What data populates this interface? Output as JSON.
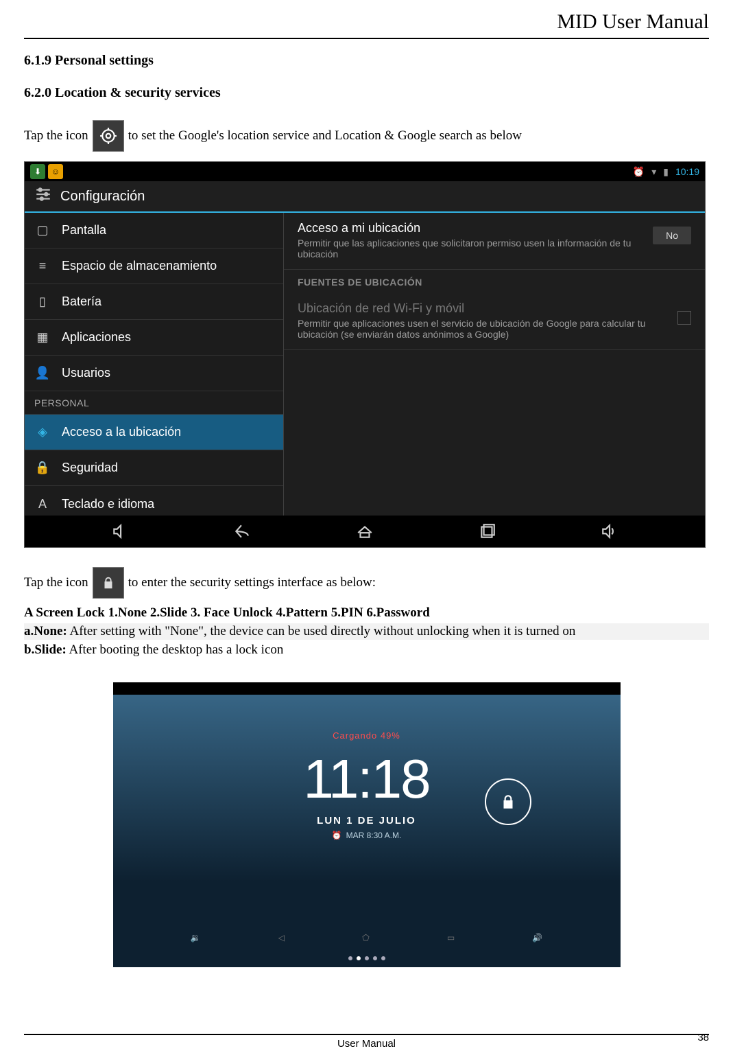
{
  "doc": {
    "header": "MID User Manual",
    "section1": "6.1.9 Personal settings",
    "section2": "6.2.0 Location & security services",
    "tap_line_pre": "Tap the icon",
    "tap_line1_post": "to set the Google's location service and Location & Google search as below",
    "tap_line2_post": "to enter the security settings interface as below:",
    "screen_lock_line": "A Screen Lock 1.None    2.Slide    3. Face Unlock    4.Pattern      5.PIN    6.Password",
    "a_none_label": "a.None:",
    "a_none_text": " After setting with \"None\", the device can be used directly without unlocking when it is turned on",
    "b_slide_label": "b.Slide:",
    "b_slide_text": " After booting the desktop has a lock icon",
    "footer": "User Manual",
    "page": "38"
  },
  "shot1": {
    "status": {
      "time": "10:19"
    },
    "title": "Configuración",
    "sidebar": {
      "personal_header": "PERSONAL",
      "items_top": [
        {
          "label": "Pantalla",
          "icon": "display"
        },
        {
          "label": "Espacio de almacenamiento",
          "icon": "storage"
        },
        {
          "label": "Batería",
          "icon": "battery"
        },
        {
          "label": "Aplicaciones",
          "icon": "apps"
        },
        {
          "label": "Usuarios",
          "icon": "users"
        }
      ],
      "items_personal": [
        {
          "label": "Acceso a la ubicación",
          "icon": "location",
          "selected": true
        },
        {
          "label": "Seguridad",
          "icon": "lock"
        },
        {
          "label": "Teclado e idioma",
          "icon": "keyboard"
        }
      ]
    },
    "main": {
      "access_title": "Acceso a mi ubicación",
      "access_desc": "Permitir que las aplicaciones que solicitaron permiso usen la información de tu ubicación",
      "toggle_off": "No",
      "sources_header": "FUENTES DE UBICACIÓN",
      "wifi_title": "Ubicación de red Wi-Fi y móvil",
      "wifi_desc": "Permitir que aplicaciones usen el servicio de ubicación de Google para calcular tu ubicación (se enviarán datos anónimos a Google)"
    }
  },
  "shot2": {
    "charging": "Cargando 49%",
    "time": "11:18",
    "date": "LUN 1 DE JULIO",
    "alarm": "MAR 8:30 A.M."
  }
}
